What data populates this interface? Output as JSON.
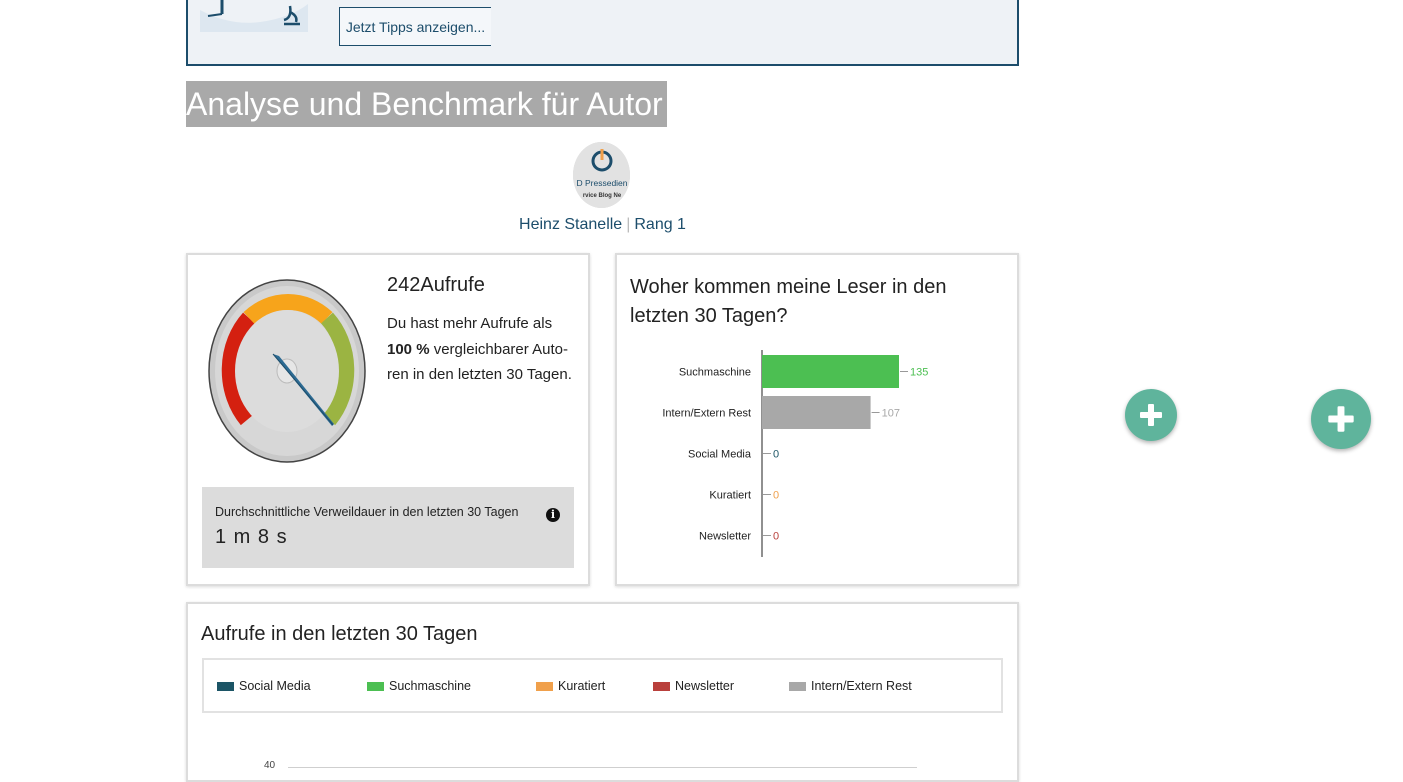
{
  "tip_banner": {
    "button_label": "Jetzt Tipps anzeigen..."
  },
  "page_title": "Analyse und Benchmark für Autor",
  "author": {
    "avatar_text_1": "D Pressedien",
    "avatar_text_2": "rvice Blog Ne",
    "name": "Heinz Stanelle",
    "separator": "|",
    "rank": "Rang 1"
  },
  "views_card": {
    "value": "242Aufrufe",
    "text_prefix": "Du hast mehr Aufrufe als ",
    "text_bold": "100 %",
    "text_suffix": " vergleichbarer Auto-ren in den letzten 30 Tagen.",
    "gauge_percent": 100,
    "dwell_label": "Durchschnittliche Verweildauer in den letzten 30 Tagen",
    "dwell_value": "1 m 8 s",
    "info_icon_glyph": "i"
  },
  "sources_card": {
    "title": "Woher kommen meine Leser in den letzten 30 Tagen?"
  },
  "chart_data": {
    "type": "bar",
    "orientation": "horizontal",
    "categories": [
      "Suchmaschine",
      "Intern/Extern Rest",
      "Social Media",
      "Kuratiert",
      "Newsletter"
    ],
    "values": [
      135,
      107,
      0,
      0,
      0
    ],
    "colors": [
      "#4cbf52",
      "#a8a8a8",
      "#1c5566",
      "#f0a04b",
      "#b9403c"
    ],
    "xlim": [
      0,
      135
    ]
  },
  "timeline_card": {
    "title": "Aufrufe in den letzten 30 Tagen",
    "legend": [
      {
        "label": "Social Media",
        "color": "#1c5566"
      },
      {
        "label": "Suchmaschine",
        "color": "#4cbf52"
      },
      {
        "label": "Kuratiert",
        "color": "#f0a04b"
      },
      {
        "label": "Newsletter",
        "color": "#b9403c"
      },
      {
        "label": "Intern/Extern Rest",
        "color": "#a8a8a8"
      }
    ],
    "y_tick_top": "40"
  },
  "fab": {
    "glyph": "+"
  }
}
